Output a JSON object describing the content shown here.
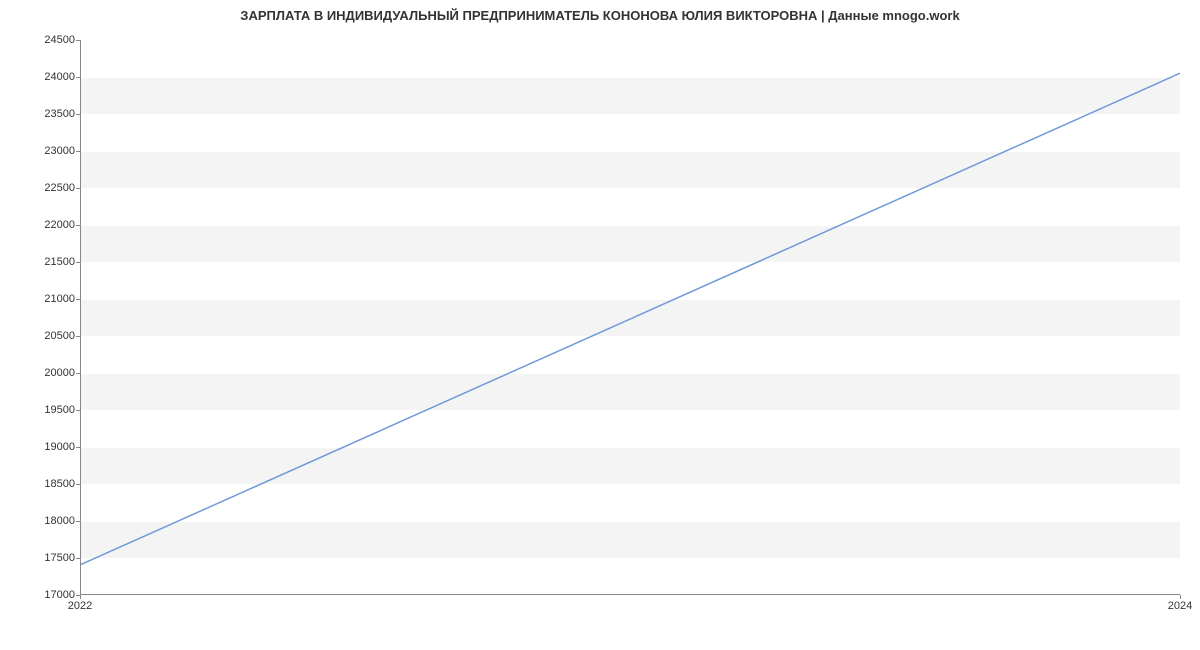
{
  "chart_data": {
    "type": "line",
    "title": "ЗАРПЛАТА В ИНДИВИДУАЛЬНЫЙ ПРЕДПРИНИМАТЕЛЬ КОНОНОВА ЮЛИЯ ВИКТОРОВНА | Данные mnogo.work",
    "x": [
      2022,
      2024
    ],
    "values": [
      17400,
      24050
    ],
    "xlabel": "",
    "ylabel": "",
    "xlim": [
      2022,
      2024
    ],
    "ylim": [
      17000,
      24500
    ],
    "x_ticks": [
      2022,
      2024
    ],
    "y_ticks": [
      17000,
      17500,
      18000,
      18500,
      19000,
      19500,
      20000,
      20500,
      21000,
      21500,
      22000,
      22500,
      23000,
      23500,
      24000,
      24500
    ]
  }
}
